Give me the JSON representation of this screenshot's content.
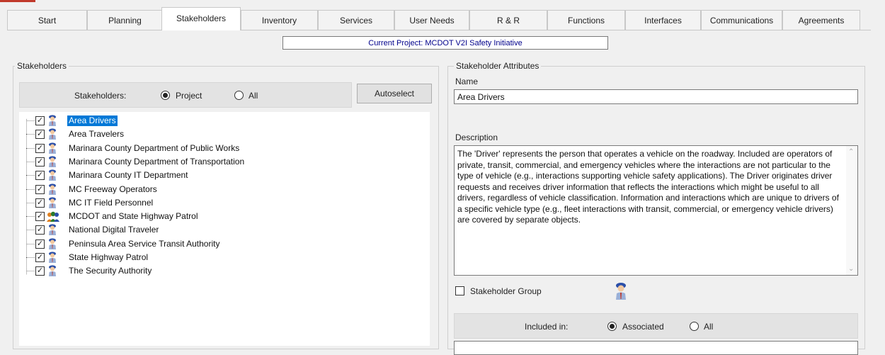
{
  "tabs": [
    "Start",
    "Planning",
    "Stakeholders",
    "Inventory",
    "Services",
    "User Needs",
    "R & R",
    "Functions",
    "Interfaces",
    "Communications",
    "Agreements"
  ],
  "active_tab": "Stakeholders",
  "current_project": "Current Project: MCDOT V2I Safety Initiative",
  "stakeholders_panel": {
    "title": "Stakeholders",
    "filter_label": "Stakeholders:",
    "option_project": "Project",
    "option_all": "All",
    "selected_option": "Project",
    "autoselect_label": "Autoselect",
    "items": [
      {
        "label": "Area Drivers",
        "checked": true,
        "selected": true,
        "icon": "person-icon"
      },
      {
        "label": "Area Travelers",
        "checked": true,
        "selected": false,
        "icon": "person-icon"
      },
      {
        "label": "Marinara County Department of Public Works",
        "checked": true,
        "selected": false,
        "icon": "person-icon"
      },
      {
        "label": "Marinara County Department of Transportation",
        "checked": true,
        "selected": false,
        "icon": "person-icon"
      },
      {
        "label": "Marinara County IT Department",
        "checked": true,
        "selected": false,
        "icon": "person-icon"
      },
      {
        "label": "MC Freeway Operators",
        "checked": true,
        "selected": false,
        "icon": "person-icon"
      },
      {
        "label": "MC IT Field Personnel",
        "checked": true,
        "selected": false,
        "icon": "person-icon"
      },
      {
        "label": "MCDOT and State Highway Patrol",
        "checked": true,
        "selected": false,
        "icon": "group-icon"
      },
      {
        "label": "National Digital Traveler",
        "checked": true,
        "selected": false,
        "icon": "person-icon"
      },
      {
        "label": "Peninsula Area Service Transit Authority",
        "checked": true,
        "selected": false,
        "icon": "person-icon"
      },
      {
        "label": "State Highway Patrol",
        "checked": true,
        "selected": false,
        "icon": "person-icon"
      },
      {
        "label": "The Security Authority",
        "checked": true,
        "selected": false,
        "icon": "person-icon"
      }
    ]
  },
  "attributes_panel": {
    "title": "Stakeholder Attributes",
    "name_label": "Name",
    "name_value": "Area Drivers",
    "description_label": "Description",
    "description_value": "The 'Driver' represents the person that operates a vehicle on the roadway.  Included are operators of private, transit, commercial, and emergency vehicles where the interactions are not particular to the type of vehicle (e.g., interactions supporting vehicle safety applications).  The Driver originates driver requests and receives driver information that reflects the interactions which might be useful to all drivers, regardless of vehicle classification.  Information and interactions which are unique to drivers of a specific vehicle type (e.g., fleet interactions with transit, commercial, or emergency vehicle drivers) are covered by separate objects.",
    "stakeholder_group_label": "Stakeholder Group",
    "stakeholder_group_checked": false,
    "included_in_label": "Included in:",
    "option_associated": "Associated",
    "option_all": "All",
    "selected_option": "Associated"
  },
  "colors": {
    "selection": "#0078d7",
    "project_text": "#00008b",
    "accent": "#c0392b"
  }
}
